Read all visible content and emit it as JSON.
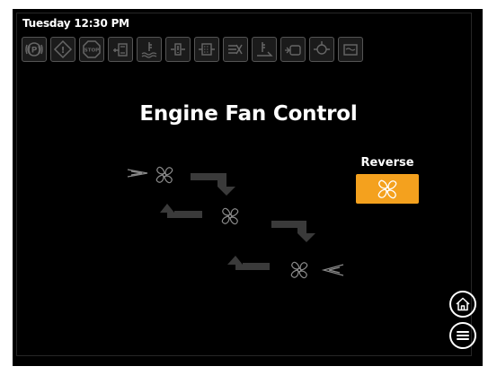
{
  "status": {
    "datetime": "Tuesday 12:30 PM"
  },
  "warning_icons": [
    {
      "name": "parking-brake-icon",
      "label": "(P)"
    },
    {
      "name": "warning-icon",
      "label": "!"
    },
    {
      "name": "stop-icon",
      "label": "STOP"
    },
    {
      "name": "engine-coolant-level-icon"
    },
    {
      "name": "coolant-temperature-icon"
    },
    {
      "name": "hydraulic-filter-icon"
    },
    {
      "name": "fuel-filter-icon"
    },
    {
      "name": "air-filter-restriction-icon"
    },
    {
      "name": "transmission-oil-temperature-icon"
    },
    {
      "name": "engine-oil-level-icon"
    },
    {
      "name": "engine-oil-pressure-icon"
    },
    {
      "name": "transmission-fluid-icon"
    }
  ],
  "main": {
    "title": "Engine Fan Control"
  },
  "reverse": {
    "label": "Reverse",
    "active_color": "#f4a11e"
  },
  "colors": {
    "background": "#000000",
    "arrow": "#3a3a3a",
    "icon_inactive": "#555555",
    "text": "#ffffff"
  }
}
